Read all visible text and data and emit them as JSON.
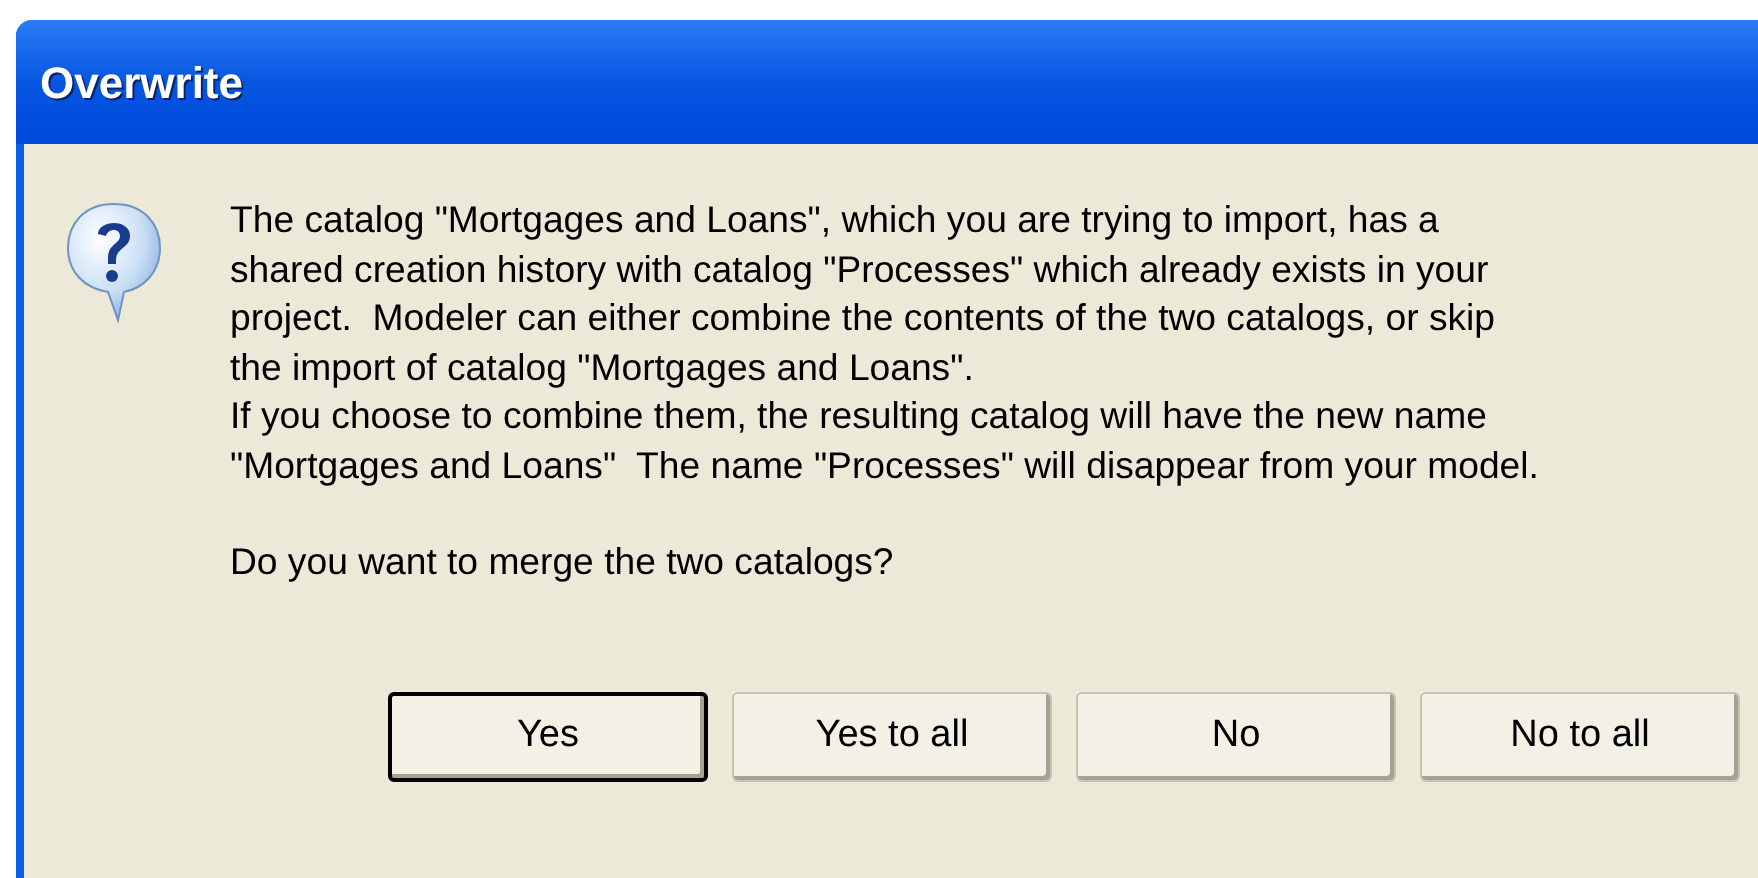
{
  "window": {
    "title": "Overwrite"
  },
  "message_lines": [
    "The catalog \"Mortgages and Loans\", which you are trying to import, has a",
    "shared creation history with catalog \"Processes\" which already exists in your",
    "project.  Modeler can either combine the contents of the two catalogs, or skip",
    "the import of catalog \"Mortgages and Loans\".",
    "If you choose to combine them, the resulting catalog will have the new name",
    "\"Mortgages and Loans\"  The name \"Processes\" will disappear from your model."
  ],
  "question": "Do you want to merge the two catalogs?",
  "buttons": [
    {
      "label": "Yes",
      "default": true
    },
    {
      "label": "Yes to all",
      "default": false
    },
    {
      "label": "No",
      "default": false
    },
    {
      "label": "No to all",
      "default": false
    }
  ]
}
